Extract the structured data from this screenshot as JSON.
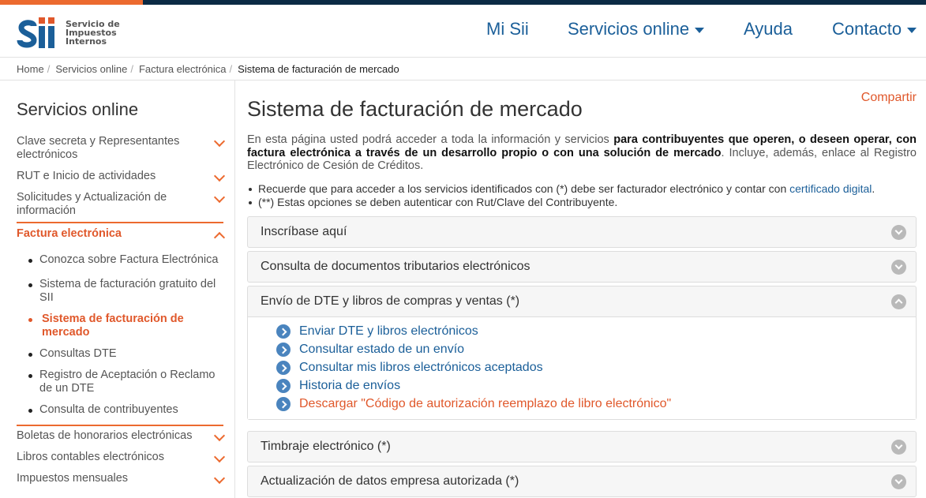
{
  "header": {
    "logo_lines": [
      "Servicio de",
      "Impuestos",
      "Internos"
    ],
    "nav": {
      "mi_sii": "Mi Sii",
      "servicios": "Servicios online",
      "ayuda": "Ayuda",
      "contacto": "Contacto"
    }
  },
  "breadcrumb": {
    "items": [
      "Home",
      "Servicios online",
      "Factura electrónica"
    ],
    "current": "Sistema de facturación de mercado"
  },
  "sidebar": {
    "title": "Servicios online",
    "items": [
      {
        "label": "Clave secreta y Representantes electrónicos"
      },
      {
        "label": "RUT e Inicio de actividades"
      },
      {
        "label": "Solicitudes y Actualización de información"
      },
      {
        "label": "Factura electrónica"
      },
      {
        "label": "Boletas de honorarios electrónicas"
      },
      {
        "label": "Libros contables electrónicos"
      },
      {
        "label": "Impuestos mensuales"
      }
    ],
    "sub_items": [
      "Conozca sobre Factura Electrónica",
      "Sistema de facturación gratuito del SII",
      "Sistema de facturación de mercado",
      "Consultas DTE",
      "Registro de Aceptación o Reclamo de un DTE",
      "Consulta de contribuyentes"
    ]
  },
  "main": {
    "share": "Compartir",
    "title": "Sistema de facturación de mercado",
    "intro_pre": "En esta página usted podrá acceder a toda la información y servicios ",
    "intro_bold": "para contribuyentes que operen, o deseen operar, con factura electrónica a través de un desarrollo propio o con una solución de mercado",
    "intro_post": ". Incluye, además, enlace al Registro Electrónico de Cesión de Créditos.",
    "note1_pre": "Recuerde que para acceder a los servicios identificados con (*) debe ser facturador electrónico y contar con ",
    "note1_link": "certificado digital",
    "note1_post": ".",
    "note2": "(**) Estas opciones se deben autenticar con Rut/Clave del Contribuyente.",
    "panels": [
      {
        "title": "Inscríbase aquí"
      },
      {
        "title": "Consulta de documentos tributarios electrónicos"
      },
      {
        "title": "Envío de DTE y libros de compras y ventas (*)"
      },
      {
        "title": "Timbraje electrónico (*)"
      },
      {
        "title": "Actualización de datos empresa autorizada (*)"
      }
    ],
    "envio_links": [
      "Enviar DTE y libros electrónicos",
      "Consultar estado de un envío",
      "Consultar mis libros electrónicos aceptados",
      "Historia de envíos",
      "Descargar \"Código de autorización reemplazo de libro electrónico\""
    ]
  },
  "colors": {
    "brand_blue": "#1b5f99",
    "accent_orange": "#ec6a2f",
    "topbar": "#0b2a44"
  }
}
